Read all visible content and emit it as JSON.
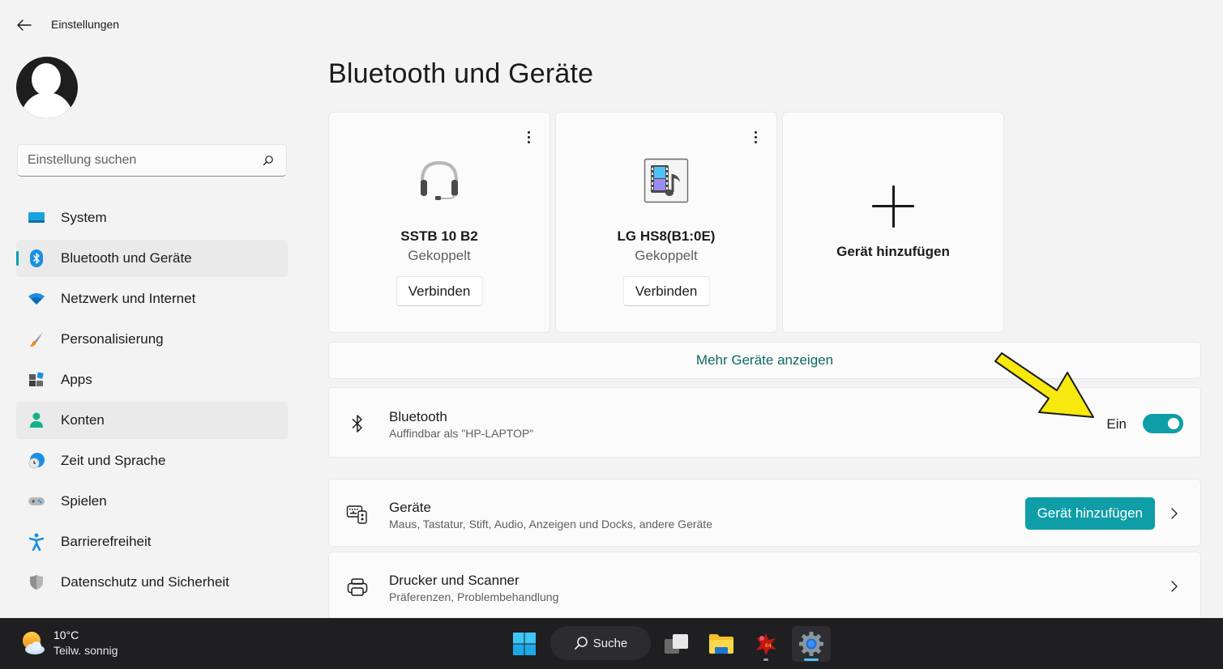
{
  "window": {
    "title": "Einstellungen",
    "back_icon": "arrow-left-icon"
  },
  "sidebar": {
    "avatar_icon": "user-avatar-icon",
    "search": {
      "placeholder": "Einstellung suchen",
      "value": "",
      "icon": "search-icon"
    },
    "items": [
      {
        "label": "System",
        "icon": "system-monitor-icon",
        "selected": false
      },
      {
        "label": "Bluetooth und Geräte",
        "icon": "bluetooth-icon",
        "selected": true
      },
      {
        "label": "Netzwerk und Internet",
        "icon": "wifi-icon",
        "selected": false
      },
      {
        "label": "Personalisierung",
        "icon": "paintbrush-icon",
        "selected": false
      },
      {
        "label": "Apps",
        "icon": "apps-icon",
        "selected": false
      },
      {
        "label": "Konten",
        "icon": "account-icon",
        "selected": false,
        "hover": true
      },
      {
        "label": "Zeit und Sprache",
        "icon": "globe-clock-icon",
        "selected": false
      },
      {
        "label": "Spielen",
        "icon": "gamepad-icon",
        "selected": false
      },
      {
        "label": "Barrierefreiheit",
        "icon": "accessibility-icon",
        "selected": false
      },
      {
        "label": "Datenschutz und Sicherheit",
        "icon": "shield-icon",
        "selected": false
      }
    ]
  },
  "main": {
    "title": "Bluetooth und Geräte",
    "device_cards": [
      {
        "name": "SSTB 10 B2",
        "status": "Gekoppelt",
        "action": "Verbinden",
        "icon": "headset-icon",
        "menu_icon": "more-vertical-icon"
      },
      {
        "name": "LG HS8(B1:0E)",
        "status": "Gekoppelt",
        "action": "Verbinden",
        "icon": "multimedia-device-icon",
        "menu_icon": "more-vertical-icon"
      }
    ],
    "add_card": {
      "label": "Gerät hinzufügen",
      "icon": "plus-icon"
    },
    "more_devices_link": "Mehr Geräte anzeigen",
    "bluetooth_row": {
      "title": "Bluetooth",
      "subtitle": "Auffindbar als \"HP-LAPTOP\"",
      "icon": "bluetooth-icon",
      "toggle_label": "Ein",
      "toggle_on": true
    },
    "devices_row": {
      "title": "Geräte",
      "subtitle": "Maus, Tastatur, Stift, Audio, Anzeigen und Docks, andere Geräte",
      "icon": "devices-icon",
      "button_label": "Gerät hinzufügen",
      "chevron_icon": "chevron-right-icon"
    },
    "printers_row": {
      "title": "Drucker und Scanner",
      "subtitle": "Präferenzen, Problembehandlung",
      "icon": "printer-icon",
      "chevron_icon": "chevron-right-icon"
    },
    "annotation": {
      "icon": "yellow-arrow-annotation",
      "color": "#f7e80f"
    }
  },
  "taskbar": {
    "weather": {
      "temperature": "10°C",
      "condition": "Teilw. sonnig",
      "icon": "partly-sunny-icon"
    },
    "search_label": "Suche",
    "apps": [
      {
        "name": "start",
        "icon": "windows-logo-icon"
      },
      {
        "name": "task-view",
        "icon": "task-view-icon"
      },
      {
        "name": "file-explorer",
        "icon": "folder-icon"
      },
      {
        "name": "app-red",
        "icon": "red-app-icon",
        "running": true
      },
      {
        "name": "settings",
        "icon": "gear-icon",
        "active": true
      }
    ]
  },
  "colors": {
    "accent": "#0f9ea8",
    "link": "#0e6a62",
    "background": "#f3f3f3",
    "card": "#fbfbfb",
    "taskbar": "#1f1f22"
  }
}
